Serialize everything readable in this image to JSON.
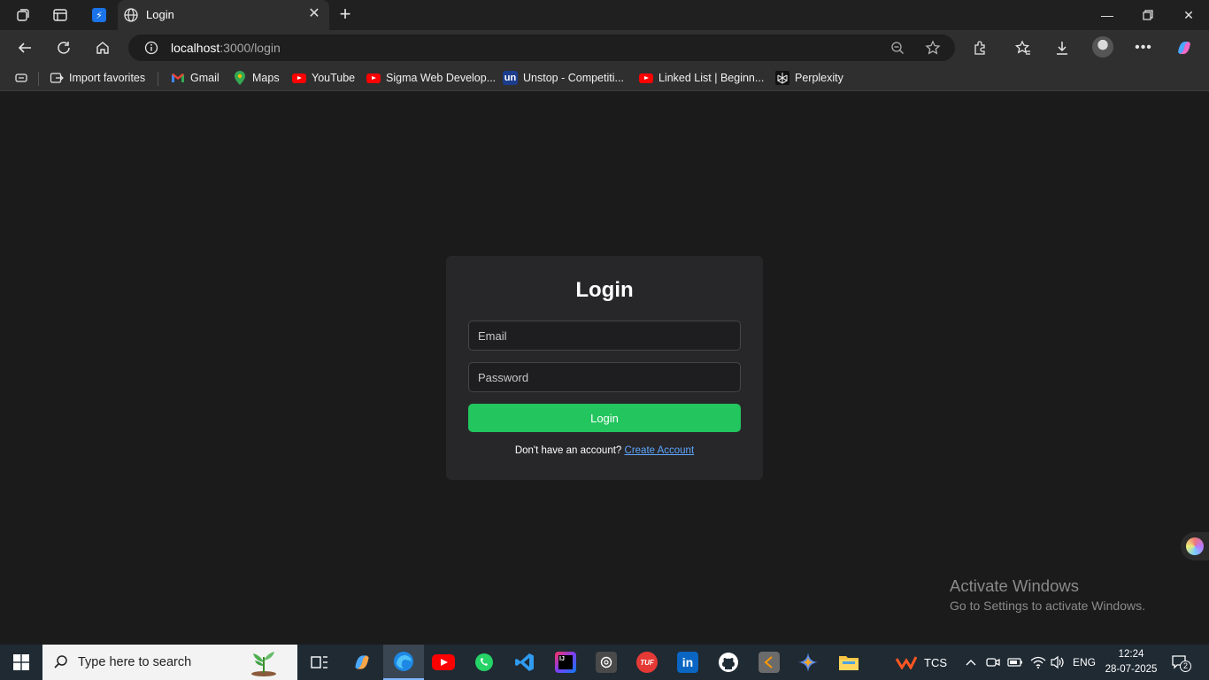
{
  "browser": {
    "tab_title": "Login",
    "url_host": "localhost",
    "url_path": ":3000/login"
  },
  "favorites": [
    {
      "label": "Import favorites",
      "icon": "import-icon"
    },
    {
      "label": "Gmail",
      "icon": "gmail-icon"
    },
    {
      "label": "Maps",
      "icon": "maps-icon"
    },
    {
      "label": "YouTube",
      "icon": "youtube-icon"
    },
    {
      "label": "Sigma Web Develop...",
      "icon": "youtube-icon"
    },
    {
      "label": "Unstop - Competiti...",
      "icon": "unstop-icon"
    },
    {
      "label": "Linked List | Beginn...",
      "icon": "youtube-icon"
    },
    {
      "label": "Perplexity",
      "icon": "perplexity-icon"
    }
  ],
  "login": {
    "title": "Login",
    "email_placeholder": "Email",
    "password_placeholder": "Password",
    "button_label": "Login",
    "signup_prompt": "Don't have an account?",
    "signup_link": "Create Account",
    "accent_color": "#22c55e"
  },
  "watermark": {
    "title": "Activate Windows",
    "subtitle": "Go to Settings to activate Windows."
  },
  "taskbar": {
    "search_placeholder": "Type here to search",
    "tray_label": "TCS",
    "language": "ENG",
    "time": "12:24",
    "date": "28-07-2025",
    "notification_count": "2"
  }
}
